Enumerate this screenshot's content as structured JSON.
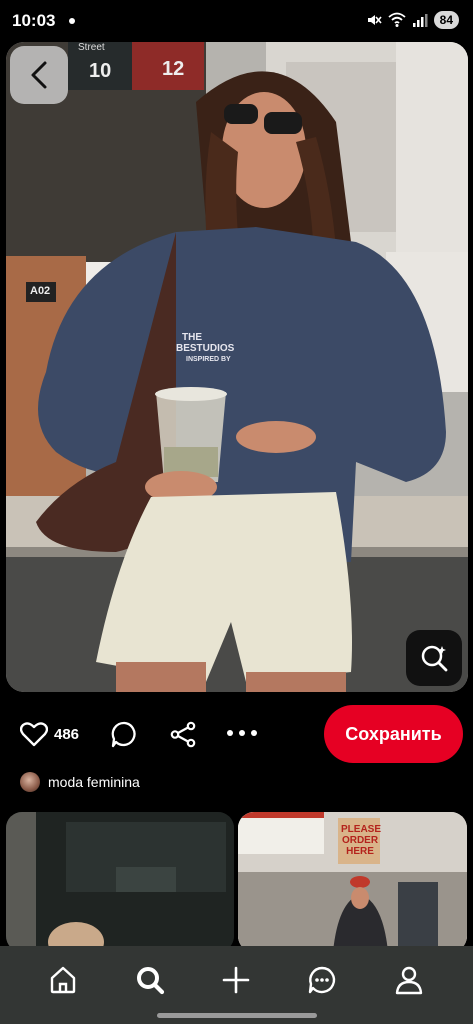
{
  "status_bar": {
    "time": "10:03",
    "battery": "84",
    "icons": [
      "mute-icon",
      "wifi-icon",
      "signal-icon"
    ]
  },
  "pin": {
    "sweater_print_line1": "THE",
    "sweater_print_line2": "BESTUDIOS",
    "sweater_print_line3": "INSPIRED BY",
    "sign_label": "A02",
    "street_numbers": [
      "10",
      "12"
    ],
    "street_label": "Street"
  },
  "actions": {
    "likes": "486",
    "save_label": "Сохранить"
  },
  "author": {
    "name": "moda feminina"
  },
  "related": {
    "right_sign_line1": "PLEASE",
    "right_sign_line2": "ORDER",
    "right_sign_line3": "HERE"
  },
  "colors": {
    "save": "#e60023",
    "nav_bg": "#333634",
    "background": "#000000"
  }
}
